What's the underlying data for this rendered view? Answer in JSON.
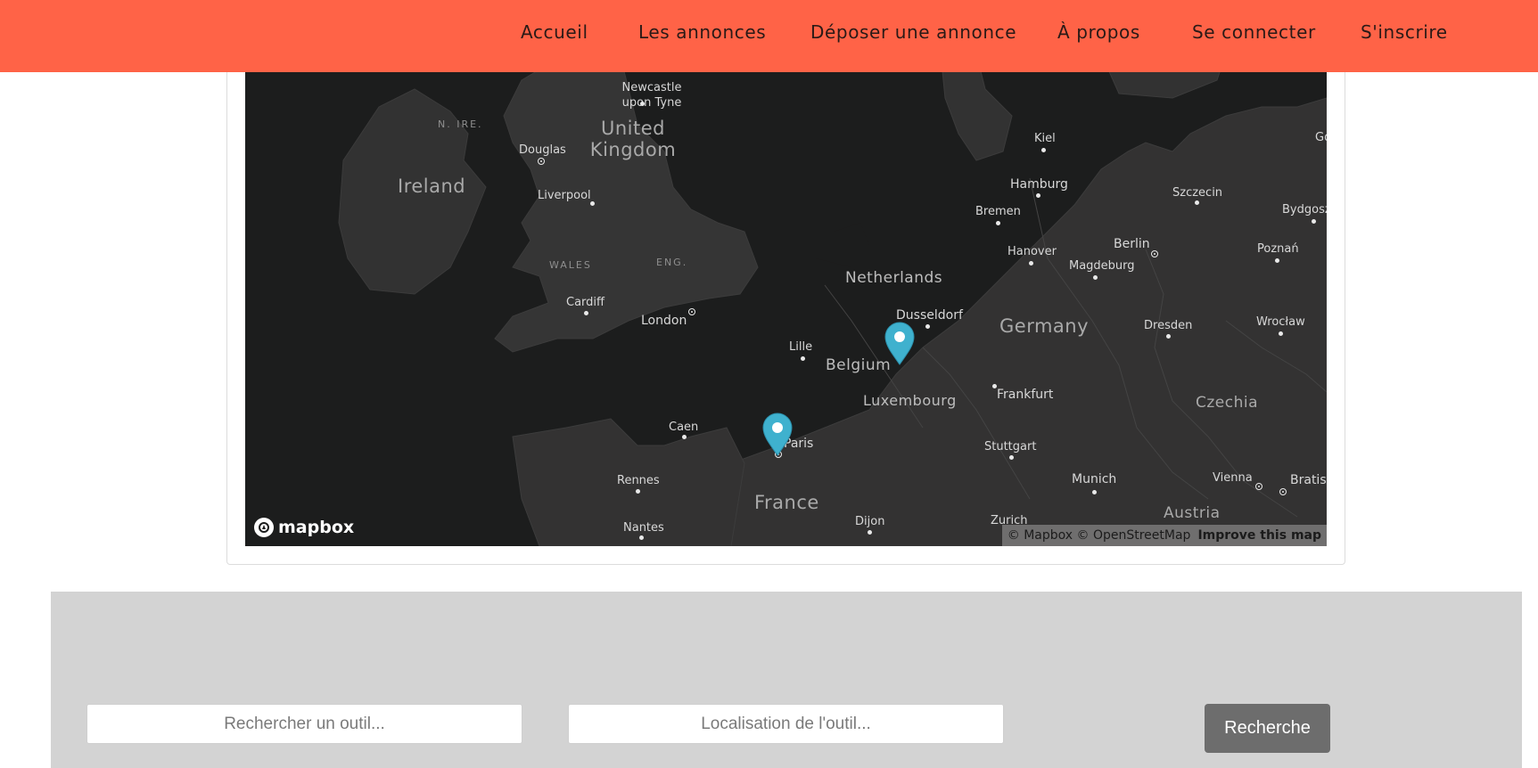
{
  "nav": {
    "items": [
      {
        "label": "Accueil"
      },
      {
        "label": "Les annonces"
      },
      {
        "label": "Déposer une annonce"
      },
      {
        "label": "À propos"
      },
      {
        "label": "Se connecter"
      },
      {
        "label": "S'inscrire"
      }
    ],
    "background_color": "#ff6347"
  },
  "map": {
    "provider_logo": "mapbox",
    "attribution": "© Mapbox © OpenStreetMap",
    "improve_link": "Improve this map",
    "countries": [
      "Ireland",
      "United Kingdom",
      "Netherlands",
      "Belgium",
      "Luxembourg",
      "Germany",
      "France",
      "Czechia",
      "Austria"
    ],
    "regions": [
      "N. IRE.",
      "WALES",
      "ENG."
    ],
    "cities": [
      "Newcastle upon Tyne",
      "Douglas",
      "Liverpool",
      "Cardiff",
      "London",
      "Lille",
      "Caen",
      "Paris",
      "Rennes",
      "Nantes",
      "Dijon",
      "Zurich",
      "Dusseldorf",
      "Kiel",
      "Hamburg",
      "Bremen",
      "Hanover",
      "Magdeburg",
      "Berlin",
      "Szczecin",
      "Bydgoszcz",
      "Poznań",
      "Frankfurt",
      "Dresden",
      "Wrocław",
      "Stuttgart",
      "Munich",
      "Vienna",
      "Bratislava",
      "Gdańsk"
    ],
    "marker_color": "#3fb1ce",
    "markers": [
      {
        "name": "paris-marker"
      },
      {
        "name": "belgium-marker"
      }
    ]
  },
  "search": {
    "tool_placeholder": "Rechercher un outil...",
    "location_placeholder": "Localisation de l'outil...",
    "button_label": "Recherche"
  }
}
